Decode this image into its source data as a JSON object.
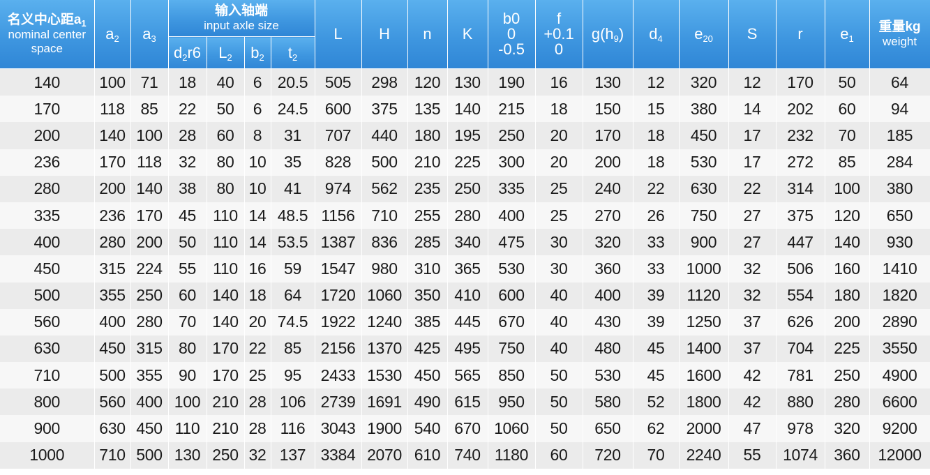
{
  "header": {
    "center_distance": {
      "cn": "名义中心距a",
      "sub": "1",
      "en": "nominal center space"
    },
    "a2": {
      "base": "a",
      "sub": "2"
    },
    "a3": {
      "base": "a",
      "sub": "3"
    },
    "input_group": {
      "cn": "输入轴端",
      "en": "input axle size"
    },
    "d2": {
      "base": "d",
      "sub": "2",
      "suffix": "r6"
    },
    "L2": {
      "base": "L",
      "sub": "2"
    },
    "b2": {
      "base": "b",
      "sub": "2"
    },
    "t2": {
      "base": "t",
      "sub": "2"
    },
    "L": "L",
    "H": "H",
    "n": "n",
    "K": "K",
    "b0": {
      "l1": "b0",
      "l2": "0",
      "l3": "-0.5"
    },
    "f": {
      "l1": "f",
      "l2": "+0.1",
      "l3": "0"
    },
    "g": {
      "base": "g(h",
      "sub": "9",
      "suffix": ")"
    },
    "d4": {
      "base": "d",
      "sub": "4"
    },
    "e20": {
      "base": "e",
      "sub": "20"
    },
    "S": "S",
    "r": "r",
    "e1": {
      "base": "e",
      "sub": "1"
    },
    "weight": {
      "cn": "重量kg",
      "en": "weight"
    }
  },
  "rows": [
    [
      "140",
      "100",
      "71",
      "18",
      "40",
      "6",
      "20.5",
      "505",
      "298",
      "120",
      "130",
      "190",
      "16",
      "130",
      "12",
      "320",
      "12",
      "170",
      "50",
      "64"
    ],
    [
      "170",
      "118",
      "85",
      "22",
      "50",
      "6",
      "24.5",
      "600",
      "375",
      "135",
      "140",
      "215",
      "18",
      "150",
      "15",
      "380",
      "14",
      "202",
      "60",
      "94"
    ],
    [
      "200",
      "140",
      "100",
      "28",
      "60",
      "8",
      "31",
      "707",
      "440",
      "180",
      "195",
      "250",
      "20",
      "170",
      "18",
      "450",
      "17",
      "232",
      "70",
      "185"
    ],
    [
      "236",
      "170",
      "118",
      "32",
      "80",
      "10",
      "35",
      "828",
      "500",
      "210",
      "225",
      "300",
      "20",
      "200",
      "18",
      "530",
      "17",
      "272",
      "85",
      "284"
    ],
    [
      "280",
      "200",
      "140",
      "38",
      "80",
      "10",
      "41",
      "974",
      "562",
      "235",
      "250",
      "335",
      "25",
      "240",
      "22",
      "630",
      "22",
      "314",
      "100",
      "380"
    ],
    [
      "335",
      "236",
      "170",
      "45",
      "110",
      "14",
      "48.5",
      "1156",
      "710",
      "255",
      "280",
      "400",
      "25",
      "270",
      "26",
      "750",
      "27",
      "375",
      "120",
      "650"
    ],
    [
      "400",
      "280",
      "200",
      "50",
      "110",
      "14",
      "53.5",
      "1387",
      "836",
      "285",
      "340",
      "475",
      "30",
      "320",
      "33",
      "900",
      "27",
      "447",
      "140",
      "930"
    ],
    [
      "450",
      "315",
      "224",
      "55",
      "110",
      "16",
      "59",
      "1547",
      "980",
      "310",
      "365",
      "530",
      "30",
      "360",
      "33",
      "1000",
      "32",
      "506",
      "160",
      "1410"
    ],
    [
      "500",
      "355",
      "250",
      "60",
      "140",
      "18",
      "64",
      "1720",
      "1060",
      "350",
      "410",
      "600",
      "40",
      "400",
      "39",
      "1120",
      "32",
      "554",
      "180",
      "1820"
    ],
    [
      "560",
      "400",
      "280",
      "70",
      "140",
      "20",
      "74.5",
      "1922",
      "1240",
      "385",
      "445",
      "670",
      "40",
      "430",
      "39",
      "1250",
      "37",
      "626",
      "200",
      "2890"
    ],
    [
      "630",
      "450",
      "315",
      "80",
      "170",
      "22",
      "85",
      "2156",
      "1370",
      "425",
      "495",
      "750",
      "40",
      "480",
      "45",
      "1400",
      "37",
      "704",
      "225",
      "3550"
    ],
    [
      "710",
      "500",
      "355",
      "90",
      "170",
      "25",
      "95",
      "2433",
      "1530",
      "450",
      "565",
      "850",
      "50",
      "530",
      "45",
      "1600",
      "42",
      "781",
      "250",
      "4900"
    ],
    [
      "800",
      "560",
      "400",
      "100",
      "210",
      "28",
      "106",
      "2739",
      "1691",
      "490",
      "615",
      "950",
      "50",
      "580",
      "52",
      "1800",
      "42",
      "880",
      "280",
      "6600"
    ],
    [
      "900",
      "630",
      "450",
      "110",
      "210",
      "28",
      "116",
      "3043",
      "1900",
      "540",
      "670",
      "1060",
      "50",
      "650",
      "62",
      "2000",
      "47",
      "978",
      "320",
      "9200"
    ],
    [
      "1000",
      "710",
      "500",
      "130",
      "250",
      "32",
      "137",
      "3384",
      "2070",
      "610",
      "740",
      "1180",
      "60",
      "720",
      "70",
      "2240",
      "55",
      "1074",
      "360",
      "12000"
    ]
  ],
  "colors": {
    "header_top": "#5ab0ee",
    "header_bottom": "#2f86d6",
    "row_odd": "#ebebeb",
    "row_even": "#f7f7f7"
  }
}
